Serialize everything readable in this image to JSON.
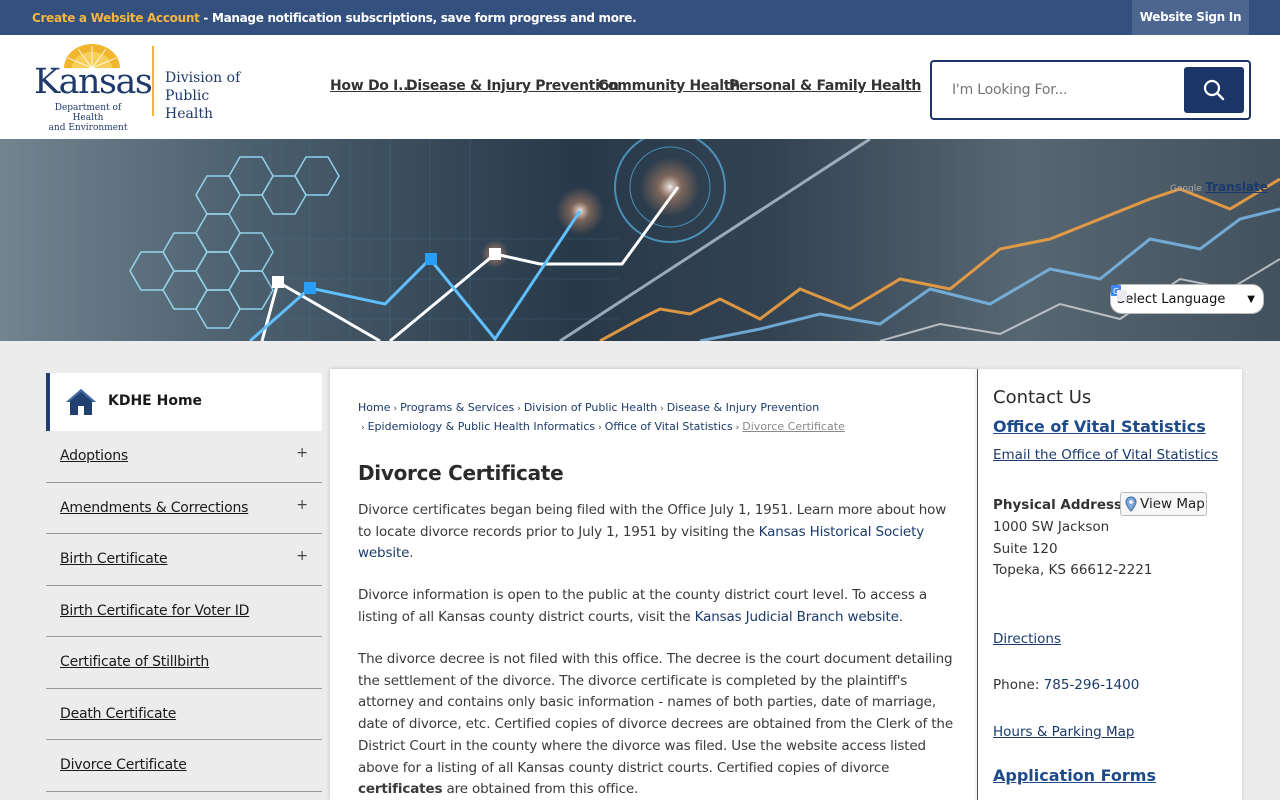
{
  "topbar": {
    "create_label": "Create a Website Account",
    "message": " - Manage notification subscriptions, save form progress and more.",
    "signin_label": "Website Sign In"
  },
  "logo": {
    "kansas": "Kansas",
    "dept_line1": "Department of Health",
    "dept_line2": "and Environment",
    "division_line1": "Division of",
    "division_line2": "Public Health"
  },
  "nav": {
    "items": [
      "How Do I...",
      "Disease & Injury Prevention",
      "Community Health",
      "Personal & Family Health"
    ]
  },
  "search": {
    "placeholder": "I'm Looking For..."
  },
  "translate": {
    "select_label": "Select Language",
    "google": "Google",
    "translate_label": "Translate"
  },
  "sidebar": {
    "home_label": "KDHE Home",
    "items": [
      {
        "label": "Adoptions",
        "expandable": "+"
      },
      {
        "label": "Amendments & Corrections",
        "expandable": "+"
      },
      {
        "label": "Birth Certificate",
        "expandable": "+"
      },
      {
        "label": "Birth Certificate for Voter ID",
        "expandable": ""
      },
      {
        "label": "Certificate of Stillbirth",
        "expandable": ""
      },
      {
        "label": "Death Certificate",
        "expandable": ""
      },
      {
        "label": "Divorce Certificate",
        "expandable": ""
      }
    ]
  },
  "breadcrumb": {
    "items": [
      "Home",
      "Programs & Services",
      "Division of Public Health",
      "Disease & Injury Prevention",
      "Epidemiology & Public Health Informatics",
      "Office of Vital Statistics"
    ],
    "current": "Divorce Certificate"
  },
  "main": {
    "title": "Divorce Certificate",
    "p1_text": "Divorce certificates began being filed with the Office July 1, 1951. Learn more about how to locate divorce records prior to July 1, 1951 by visiting the ",
    "p1_link": "Kansas Historical Society website",
    "p1_end": ".",
    "p2_text": "Divorce information is open to the public at the county district court level. To access a listing of all Kansas county district courts, visit the ",
    "p2_link": "Kansas Judicial Branch website",
    "p2_end": ".",
    "p3_text": "The divorce decree is not filed with this office. The decree is the court document detailing the settlement of the divorce. The divorce certificate is completed by the plaintiff's attorney and contains only basic information - names of both parties, date of marriage, date of divorce, etc. Certified copies of divorce decrees are obtained from the Clerk of the District Court in the county where the divorce was filed. Use the website access listed above for a listing of all Kansas county district courts. Certified copies of divorce ",
    "p3_bold": "certificates",
    "p3_end": " are obtained from this office."
  },
  "contact": {
    "title": "Contact Us",
    "office": "Office of Vital Statistics",
    "email": "Email the Office of Vital Statistics",
    "address_label": "Physical Address",
    "map_label": "View Map",
    "address_line1": "1000 SW Jackson",
    "address_line2": "Suite 120",
    "address_line3": "Topeka, KS 66612-2221",
    "directions": "Directions",
    "phone_label": "Phone: ",
    "phone": "785-296-1400",
    "hours": "Hours & Parking Map",
    "forms": "Application Forms"
  }
}
